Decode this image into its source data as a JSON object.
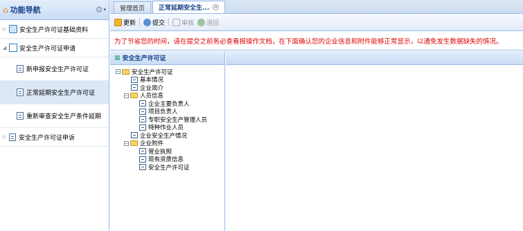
{
  "sidebar": {
    "title": "功能导航",
    "groups": [
      {
        "label": "安全生产许可证基础资料",
        "expanded": false
      },
      {
        "label": "安全生产许可证申请",
        "expanded": true,
        "items": [
          {
            "label": "新申报安全生产许可证"
          },
          {
            "label": "正常延期安全生产许可证",
            "active": true
          },
          {
            "label": "重新审查安全生产条件延期"
          }
        ]
      },
      {
        "label": "安全生产许可证申诉",
        "expanded": false
      }
    ]
  },
  "tabs": [
    {
      "label": "管理首页"
    },
    {
      "label": "正常延期安全生..."
    }
  ],
  "toolbar": {
    "refresh": "更新",
    "submit": "提交",
    "audit": "审核",
    "return": "退回"
  },
  "notice": "为了节省您的时间，请在提交之前务必查看报操作文档，在下面确认您的企业信息和附件能够正常显示，以通免发生数据缺失的情况。",
  "tree": {
    "header": "安全生产许可证",
    "root": "安全生产许可证",
    "basic": "基本情况",
    "intro": "企业简介",
    "personnel": "人员信息",
    "p1": "企业主要负责人",
    "p2": "项目负责人",
    "p3": "专职安全生产管理人员",
    "p4": "特种作业人员",
    "safety": "企业安全生产情况",
    "attach": "企业附件",
    "a1": "营业执照",
    "a2": "现有资质信息",
    "a3": "安全生产许可证"
  },
  "colors": {
    "notice": "#e00000",
    "header_text": "#15428b",
    "border": "#99bbe8"
  }
}
